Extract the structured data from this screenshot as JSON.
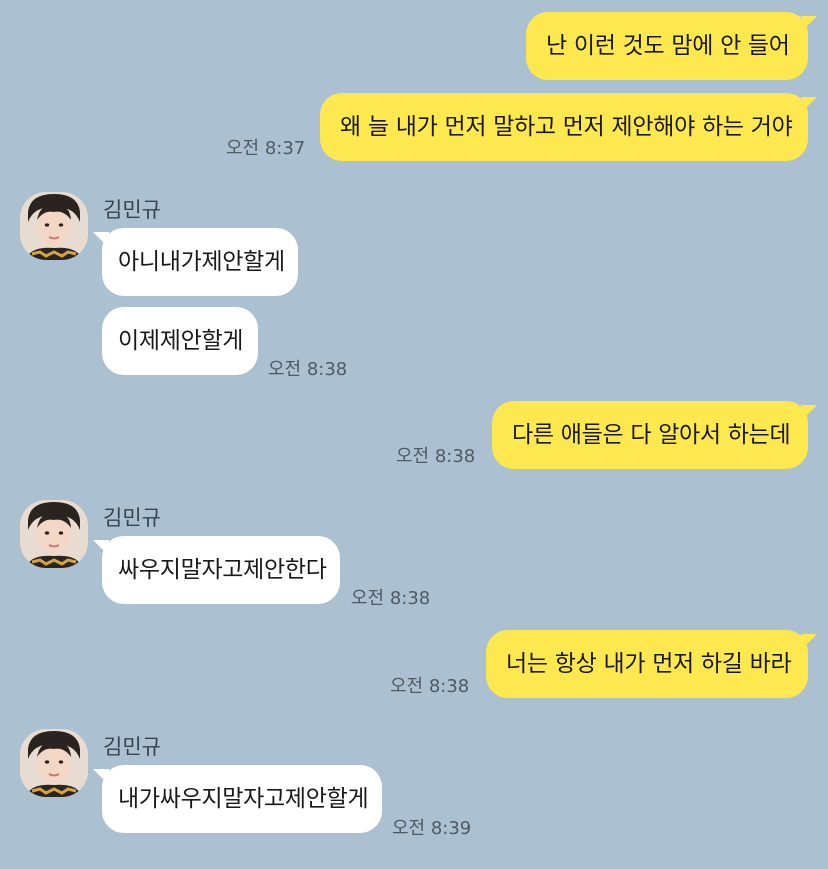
{
  "chat": {
    "messages": [
      {
        "from": "me",
        "text": "난 이런 것도 맘에 안 들어"
      },
      {
        "from": "me",
        "text": "왜 늘 내가 먼저 말하고 먼저 제안해야 하는 거야",
        "time": "오전 8:37"
      },
      {
        "from": "other",
        "sender": "김민규",
        "text": "아니내가제안할게"
      },
      {
        "from": "other",
        "text": "이제제안할게",
        "time": "오전 8:38"
      },
      {
        "from": "me",
        "text": "다른 애들은 다 알아서 하는데",
        "time": "오전 8:38"
      },
      {
        "from": "other",
        "sender": "김민규",
        "text": "싸우지말자고제안한다",
        "time": "오전 8:38"
      },
      {
        "from": "me",
        "text": "너는 항상 내가 먼저 하길 바라",
        "time": "오전 8:38"
      },
      {
        "from": "other",
        "sender": "김민규",
        "text": "내가싸우지말자고제안할게",
        "time": "오전 8:39"
      }
    ]
  },
  "colors": {
    "background": "#abc0d1",
    "my_bubble": "#fee84f",
    "other_bubble": "#ffffff"
  },
  "icons": {
    "avatar": "profile-photo"
  }
}
